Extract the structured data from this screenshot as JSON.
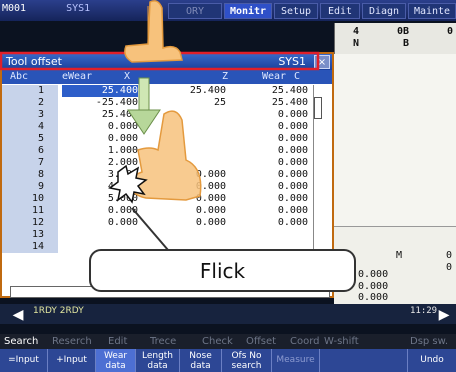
{
  "menubar": {
    "left_label": "M001",
    "sys_label": "SYS1",
    "tabs": [
      {
        "label": "ORY",
        "state": "dim"
      },
      {
        "label": "Monitr",
        "state": "active"
      },
      {
        "label": "Setup",
        "state": "normal"
      },
      {
        "label": "Edit",
        "state": "normal"
      },
      {
        "label": "Diagn",
        "state": "normal"
      },
      {
        "label": "Mainte",
        "state": "normal"
      }
    ]
  },
  "right_panel": {
    "col1": "4",
    "col1b": "N",
    "col2": "0B",
    "col2b": "B",
    "col3": "0",
    "lower_letter": "M",
    "values": [
      "0.000",
      "0.000",
      "0.000"
    ],
    "side": [
      "0",
      "0"
    ]
  },
  "window": {
    "title": "Tool offset",
    "sys": "SYS1",
    "close": "×",
    "columns": [
      "Abc",
      "eWear",
      "X",
      "Z",
      "Wear",
      "C"
    ],
    "rows": [
      {
        "n": "1",
        "wear_x": "25.400",
        "z": "25.400",
        "wear_c": "25.400",
        "sel": true
      },
      {
        "n": "2",
        "wear_x": "-25.400",
        "z": "25",
        "wear_c": "25.400"
      },
      {
        "n": "3",
        "wear_x": "25.400",
        "z": "",
        "wear_c": "0.000"
      },
      {
        "n": "4",
        "wear_x": "0.000",
        "z": "",
        "wear_c": "0.000"
      },
      {
        "n": "5",
        "wear_x": "0.000",
        "z": "",
        "wear_c": "0.000"
      },
      {
        "n": "6",
        "wear_x": "1.000",
        "z": "",
        "wear_c": "0.000"
      },
      {
        "n": "7",
        "wear_x": "2.000",
        "z": "",
        "wear_c": "0.000"
      },
      {
        "n": "8",
        "wear_x": "3.000",
        "z": "0.000",
        "wear_c": "0.000"
      },
      {
        "n": "9",
        "wear_x": "4.000",
        "z": "0.000",
        "wear_c": "0.000"
      },
      {
        "n": "10",
        "wear_x": "5.000",
        "z": "0.000",
        "wear_c": "0.000"
      },
      {
        "n": "11",
        "wear_x": "0.000",
        "z": "0.000",
        "wear_c": "0.000"
      },
      {
        "n": "12",
        "wear_x": "0.000",
        "z": "0.000",
        "wear_c": "0.000"
      },
      {
        "n": "13",
        "wear_x": "",
        "z": "",
        "wear_c": ""
      },
      {
        "n": "14",
        "wear_x": "",
        "z": "",
        "wear_c": ""
      }
    ]
  },
  "status": {
    "rdy": "1RDY 2RDY",
    "clock": "11:29"
  },
  "modes": [
    {
      "label": "Search",
      "on": true
    },
    {
      "label": "Reserch",
      "on": false
    },
    {
      "label": "Edit",
      "on": false
    },
    {
      "label": "Trece",
      "on": false
    },
    {
      "label": "Check",
      "on": false
    },
    {
      "label": "Offset",
      "on": false
    },
    {
      "label": "Coord",
      "on": false
    },
    {
      "label": "W-shift",
      "on": false
    },
    {
      "label": "Dsp sw.",
      "on": false
    }
  ],
  "softkeys": [
    {
      "label": "=Input"
    },
    {
      "label": "+Input"
    },
    {
      "label": "Wear data",
      "on": true
    },
    {
      "label": "Length data"
    },
    {
      "label": "Nose data"
    },
    {
      "label": "Ofs No search"
    },
    {
      "label": "Measure",
      "dim": true
    },
    {
      "label": ""
    },
    {
      "label": "Undo"
    }
  ],
  "gesture": {
    "label": "Flick"
  },
  "colors": {
    "accent": "#2f50c8",
    "window_border": "#c06a10",
    "select": "#2d5ec9"
  }
}
